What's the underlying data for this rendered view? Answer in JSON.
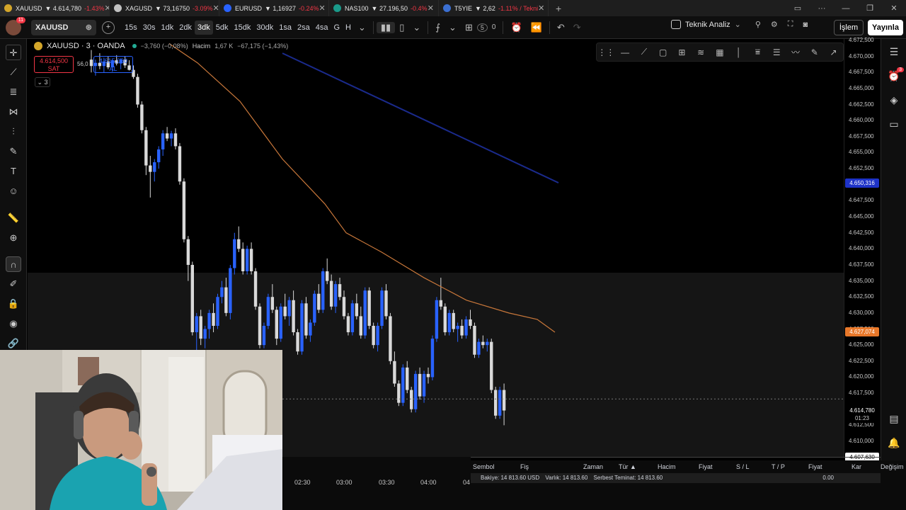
{
  "tabs": [
    {
      "symbol": "XAUUSD",
      "price": "▼ 4.614,780",
      "change": "-1.43%",
      "color": "#d4a62a"
    },
    {
      "symbol": "XAGUSD",
      "price": "▼ 73,16750",
      "change": "-3.09%",
      "color": "#c0c0c0"
    },
    {
      "symbol": "EURUSD",
      "price": "▼ 1,16927",
      "change": "-0.24%",
      "color": "#2962ff"
    },
    {
      "symbol": "NAS100",
      "price": "▼ 27.196,50",
      "change": "-0.4%",
      "color": "#1a9a8a"
    },
    {
      "symbol": "T5YIE",
      "price": "▼ 2,62",
      "change": "-1.11% / Tekni",
      "color": "#3b6fd1"
    }
  ],
  "toolbar": {
    "avatar_badge": "11",
    "symbol": "XAUUSD",
    "intervals": [
      "15s",
      "30s",
      "1dk",
      "2dk",
      "3dk",
      "5dk",
      "15dk",
      "30dk",
      "1sa",
      "2sa",
      "4sa",
      "G",
      "H"
    ],
    "selected_interval": "3dk",
    "layout_badge": "5",
    "layout_count": "0",
    "teknik": "Teknik Analiz",
    "islem": "İşlem",
    "publish": "Yayınla"
  },
  "legend": {
    "title": "XAUUSD · 3 · OANDA",
    "change": "−3,760 (−0,08%)",
    "volume_label": "Hacim",
    "volume_value": "1,67 K",
    "volume_change": "−67,175 (−1,43%)",
    "sell_price": "4.614,500",
    "sell_label": "SAT",
    "buy_price": "4.615,060",
    "buy_label": "AL",
    "spread": "56,0",
    "collapse_count": "3"
  },
  "price_axis": {
    "ticks": [
      "4.672,500",
      "4.670,000",
      "4.667,500",
      "4.665,000",
      "4.662,500",
      "4.660,000",
      "4.657,500",
      "4.655,000",
      "4.652,500",
      "4.650,000",
      "4.647,500",
      "4.645,000",
      "4.642,500",
      "4.640,000",
      "4.637,500",
      "4.635,000",
      "4.632,500",
      "4.630,000",
      "4.627,500",
      "4.625,000",
      "4.622,500",
      "4.620,000",
      "4.617,500",
      "4.615,000",
      "4.612,500",
      "4.610,000"
    ],
    "blue_label": "4.650,316",
    "orange_label": "4.627,074",
    "current_price": "4.614,780",
    "countdown": "01:23",
    "bottom_label": "4.607,630"
  },
  "time_axis": [
    "02:30",
    "03:00",
    "03:30",
    "04:00",
    "04"
  ],
  "panel": {
    "columns": [
      "Sembol",
      "Fiş",
      "Zaman",
      "Tür ▲",
      "Hacim",
      "Fiyat",
      "S / L",
      "T / P",
      "Fiyat",
      "Kar",
      "Değişim"
    ],
    "balance": "Bakiye: 14 813.60 USD",
    "equity": "Varlık: 14 813.60",
    "margin": "Serbest Teminat: 14 813.60",
    "profit": "0.00"
  },
  "right_badge": "3",
  "colors": {
    "up": "#2962ff",
    "down": "#d9d9d9",
    "ema": "#c8773a",
    "trend": "#1a2a8c",
    "sell": "#f23645"
  }
}
